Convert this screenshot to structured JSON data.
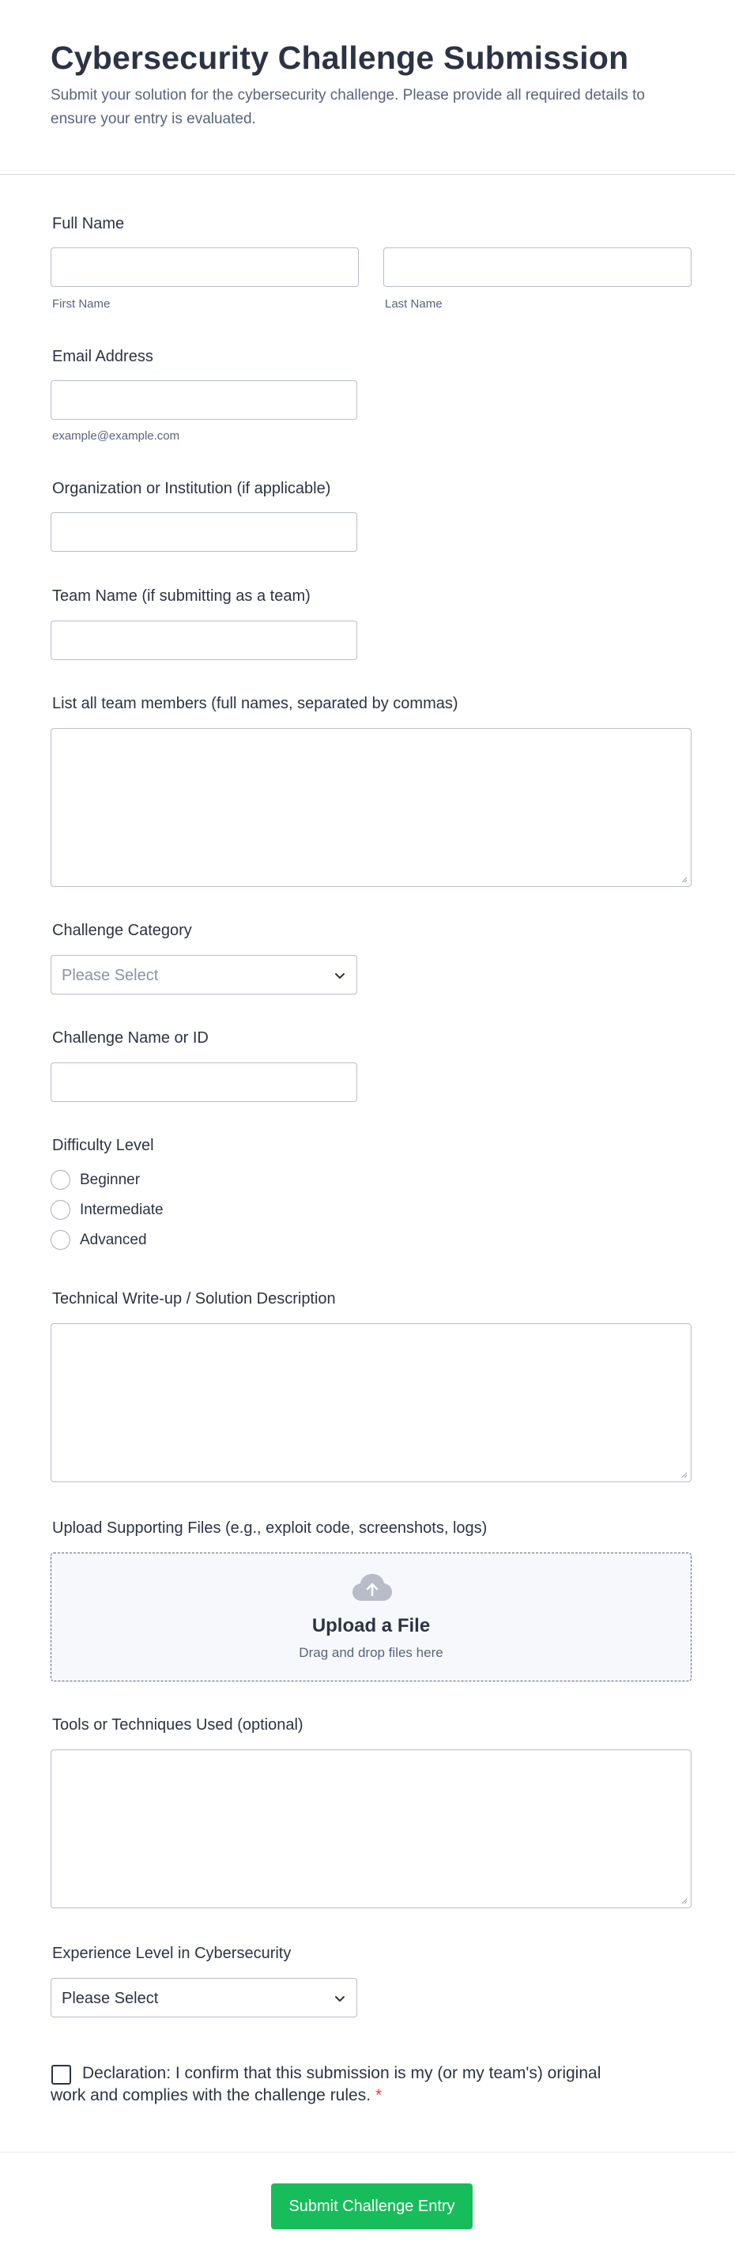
{
  "header": {
    "title": "Cybersecurity Challenge Submission",
    "subtitle": "Submit your solution for the cybersecurity challenge. Please provide all required details to ensure your entry is evaluated."
  },
  "full_name": {
    "label": "Full Name",
    "first_sublabel": "First Name",
    "last_sublabel": "Last Name",
    "first_value": "",
    "last_value": ""
  },
  "email": {
    "label": "Email Address",
    "sublabel": "example@example.com",
    "value": ""
  },
  "organization": {
    "label": "Organization or Institution (if applicable)",
    "value": ""
  },
  "team_name": {
    "label": "Team Name (if submitting as a team)",
    "value": ""
  },
  "team_members": {
    "label": "List all team members (full names, separated by commas)",
    "value": ""
  },
  "challenge_category": {
    "label": "Challenge Category",
    "placeholder": "Please Select",
    "placeholder_color": "#8a93a6"
  },
  "challenge_name": {
    "label": "Challenge Name or ID",
    "value": ""
  },
  "difficulty": {
    "label": "Difficulty Level",
    "options": [
      "Beginner",
      "Intermediate",
      "Advanced"
    ]
  },
  "writeup": {
    "label": "Technical Write-up / Solution Description",
    "value": ""
  },
  "upload": {
    "label": "Upload Supporting Files (e.g., exploit code, screenshots, logs)",
    "title": "Upload a File",
    "subtitle": "Drag and drop files here",
    "icon": "cloud-upload-icon"
  },
  "tools": {
    "label": "Tools or Techniques Used (optional)",
    "value": ""
  },
  "experience": {
    "label": "Experience Level in Cybersecurity",
    "selected": "Please Select"
  },
  "declaration": {
    "text": "Declaration: I confirm that this submission is my (or my team's) original work and complies with the challenge rules.",
    "required_mark": "*",
    "checked": false
  },
  "submit": {
    "label": "Submit Challenge Entry",
    "color": "#18bd5b"
  },
  "colors": {
    "text": "#2c3345",
    "muted": "#57647e",
    "border": "#b8bdc9",
    "required": "#f23a3c"
  }
}
